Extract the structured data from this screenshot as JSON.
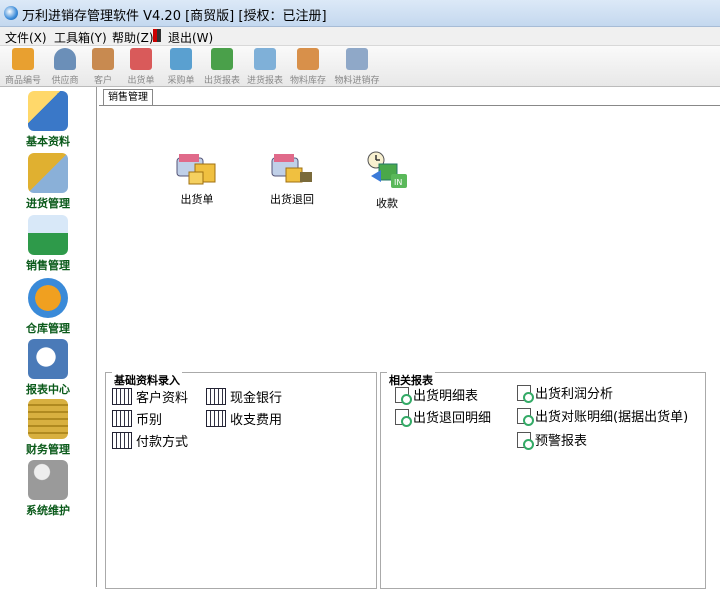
{
  "window": {
    "title": "万利进销存管理软件 V4.20 [商贸版] [授权：已注册]"
  },
  "menu": {
    "file": "文件(X)",
    "tools": "工具箱(Y)",
    "help": "帮助(Z)",
    "exit": "退出(W)"
  },
  "toolbar": [
    {
      "label": "商品编号",
      "icon": "goods-icon",
      "color": "#e8a030"
    },
    {
      "label": "供应商",
      "icon": "supplier-icon",
      "color": "#6b8fb8"
    },
    {
      "label": "客户",
      "icon": "customer-icon",
      "color": "#c88a50"
    },
    {
      "label": "出货单",
      "icon": "delivery-icon",
      "color": "#d95a5a"
    },
    {
      "label": "采购单",
      "icon": "purchase-icon",
      "color": "#5aa0d0"
    },
    {
      "label": "出货报表",
      "icon": "delivery-report-icon",
      "color": "#4aa04a"
    },
    {
      "label": "进货报表",
      "icon": "purchase-report-icon",
      "color": "#7fb0d8"
    },
    {
      "label": "物料库存",
      "icon": "inventory-icon",
      "color": "#d8904a"
    },
    {
      "label": "物料进销存",
      "icon": "material-flow-icon",
      "color": "#8fa8c8"
    }
  ],
  "sidebar": [
    {
      "label": "基本资料",
      "icon": "basic-data-icon",
      "color": "#3a78c8"
    },
    {
      "label": "进货管理",
      "icon": "purchase-management-icon",
      "color": "#e0b030"
    },
    {
      "label": "销售管理",
      "icon": "sales-management-icon",
      "color": "#2e9a4a"
    },
    {
      "label": "仓库管理",
      "icon": "warehouse-management-icon",
      "color": "#f0a020"
    },
    {
      "label": "报表中心",
      "icon": "report-center-icon",
      "color": "#4a7ab8"
    },
    {
      "label": "财务管理",
      "icon": "finance-management-icon",
      "color": "#d8b040"
    },
    {
      "label": "系统维护",
      "icon": "system-maintenance-icon",
      "color": "#9a9a9a"
    }
  ],
  "tab": {
    "label": "销售管理"
  },
  "main_icons": [
    {
      "label": "出货单",
      "icon": "delivery-order-icon"
    },
    {
      "label": "出货退回",
      "icon": "delivery-return-icon"
    },
    {
      "label": "收款",
      "icon": "payment-received-icon"
    }
  ],
  "basic_panel": {
    "title": "基础资料录入",
    "items": [
      "客户资料",
      "现金银行",
      "币别",
      "收支费用",
      "付款方式"
    ]
  },
  "report_panel": {
    "title": "相关报表",
    "items": [
      "出货明细表",
      "出货利润分析",
      "出货退回明细",
      "出货对账明细(据据出货单)",
      "预警报表"
    ]
  }
}
